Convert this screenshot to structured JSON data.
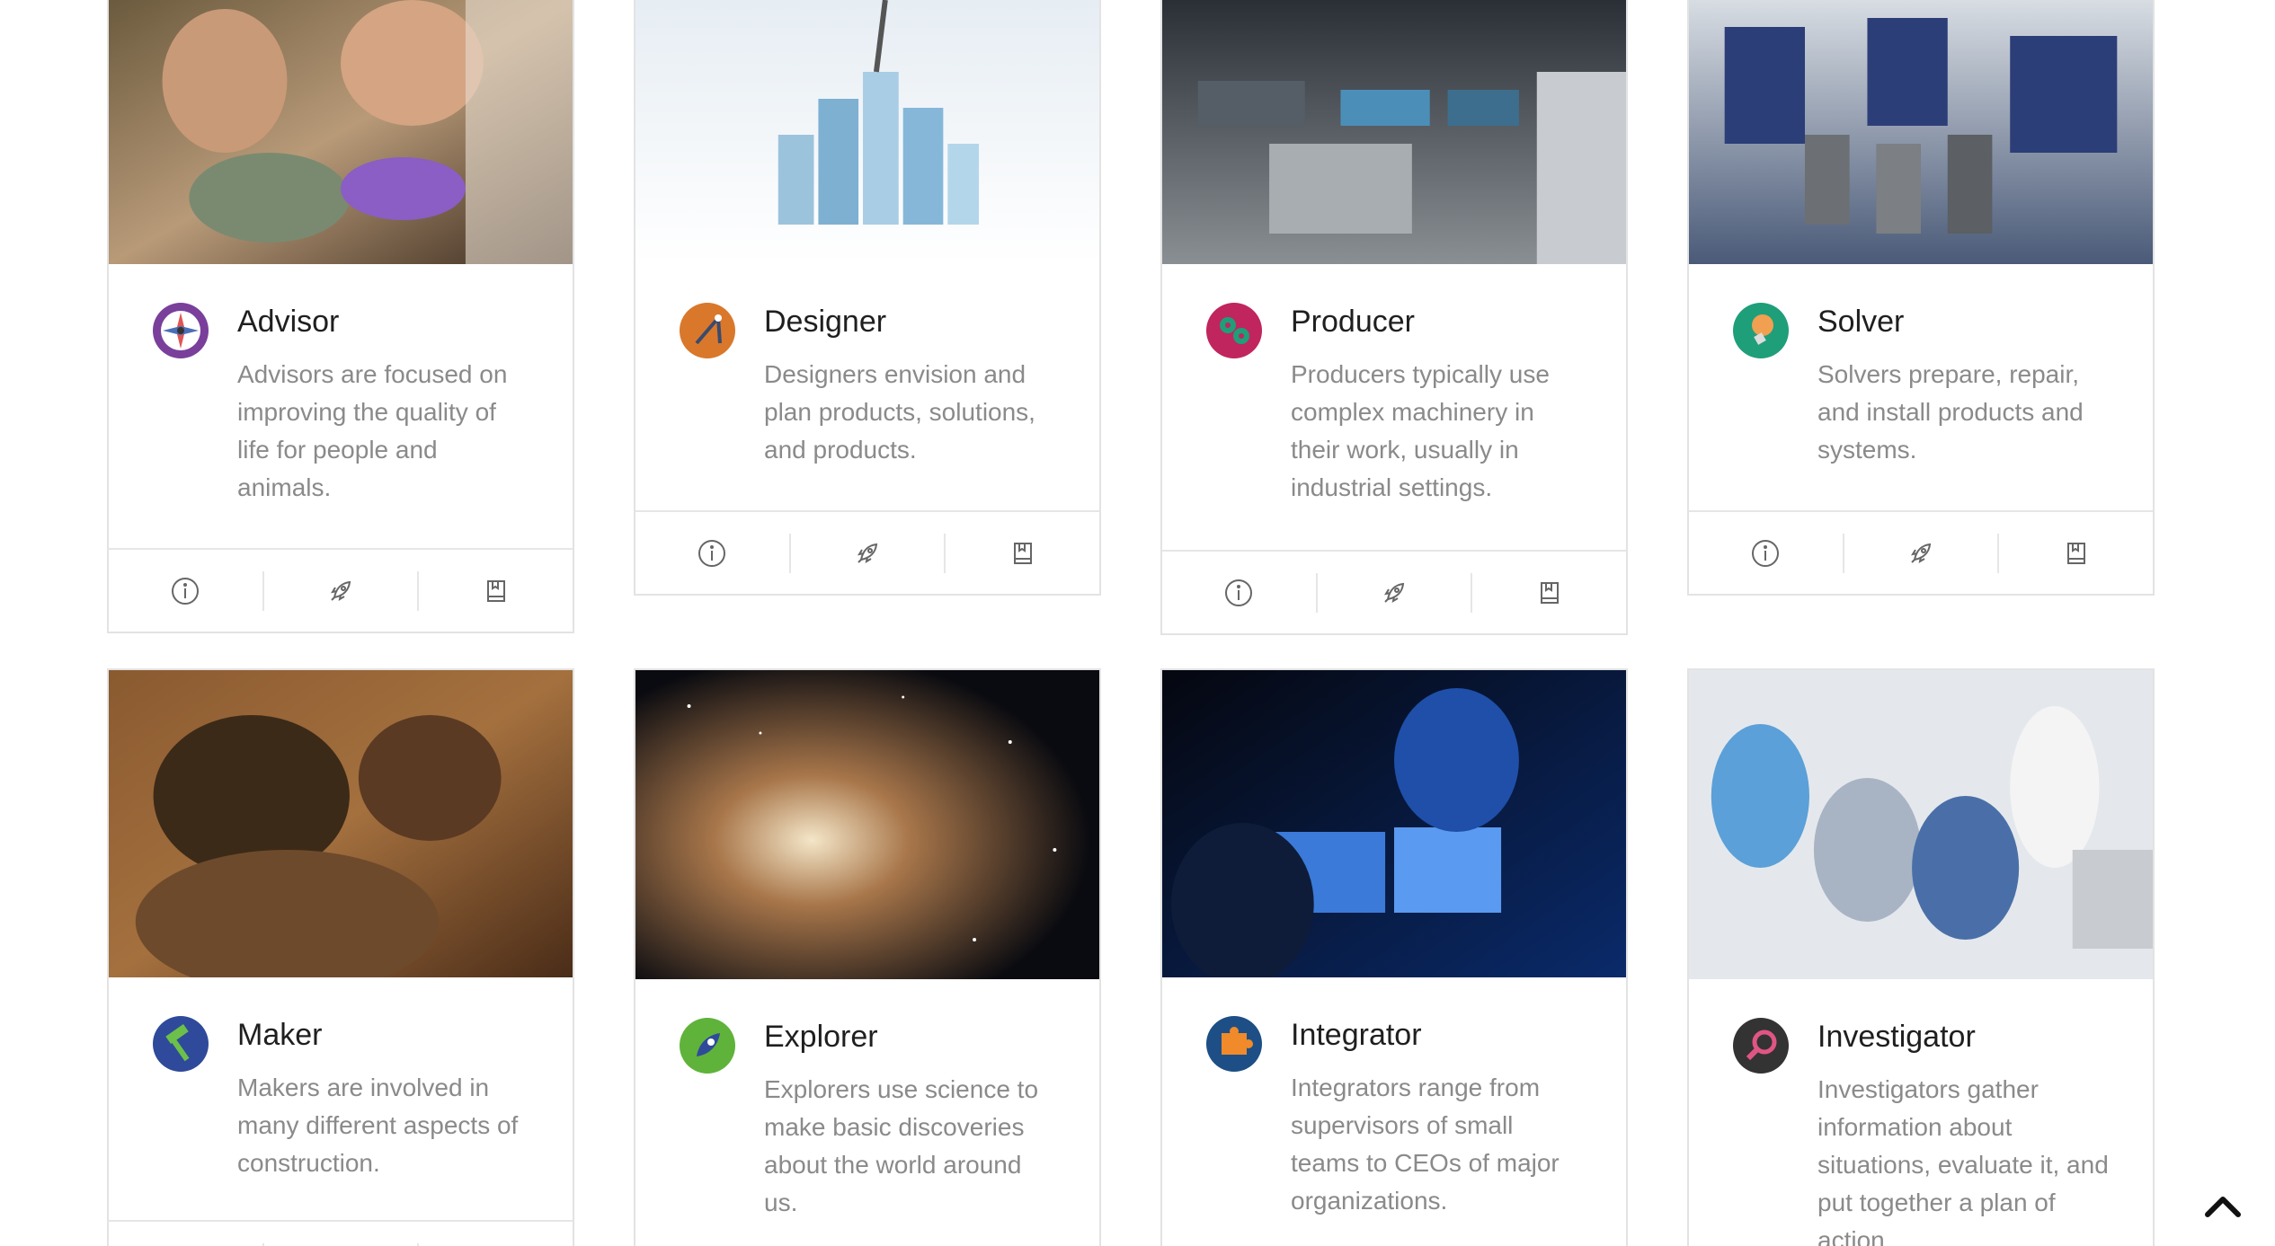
{
  "cards": [
    {
      "title": "Advisor",
      "description": "Advisors are focused on improving the quality of life for people and animals.",
      "icon": "compass-icon",
      "icon_color": "#7a3f9b"
    },
    {
      "title": "Designer",
      "description": "Designers envision and plan products, solutions, and products.",
      "icon": "drafting-compass-icon",
      "icon_color": "#d9782b"
    },
    {
      "title": "Producer",
      "description": "Producers typically use complex machinery in their work, usually in industrial settings.",
      "icon": "gears-icon",
      "icon_color": "#c0255e"
    },
    {
      "title": "Solver",
      "description": "Solvers prepare, repair, and install products and systems.",
      "icon": "lightbulb-icon",
      "icon_color": "#1f9e7a"
    },
    {
      "title": "Maker",
      "description": "Makers are involved in many different aspects of construction.",
      "icon": "hammer-icon",
      "icon_color": "#2f4a9a"
    },
    {
      "title": "Explorer",
      "description": "Explorers use science to make basic discoveries about the world around us.",
      "icon": "rocket-icon",
      "icon_color": "#5fb33a"
    },
    {
      "title": "Integrator",
      "description": "Integrators range from supervisors of small teams to CEOs of major organizations.",
      "icon": "puzzle-icon",
      "icon_color": "#1d4f86"
    },
    {
      "title": "Investigator",
      "description": "Investigators gather information about situations, evaluate it, and put together a plan of action.",
      "icon": "magnifier-icon",
      "icon_color": "#333333"
    }
  ],
  "footer_icons": [
    "info-icon",
    "rocket-icon",
    "book-icon"
  ],
  "back_to_top_icon": "chevron-up-icon"
}
